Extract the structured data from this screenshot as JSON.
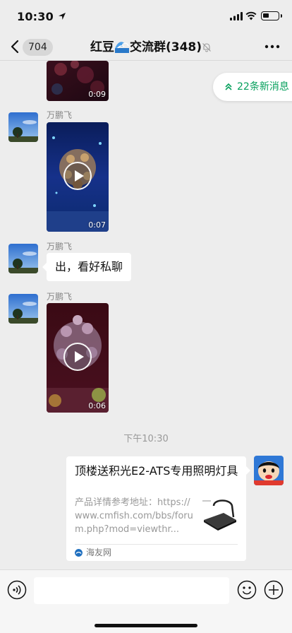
{
  "status_bar": {
    "time": "10:30"
  },
  "nav": {
    "back_count": "704",
    "title_prefix": "红豆",
    "title_suffix": "交流群(348)"
  },
  "new_messages": {
    "label": "22条新消息"
  },
  "messages": [
    {
      "type": "video",
      "duration": "0:09"
    },
    {
      "type": "video",
      "sender": "万鹏飞",
      "duration": "0:07"
    },
    {
      "type": "text",
      "sender": "万鹏飞",
      "text": "出，看好私聊"
    },
    {
      "type": "video",
      "sender": "万鹏飞",
      "duration": "0:06"
    }
  ],
  "timestamp": "下午10:30",
  "link_card": {
    "title": "顶楼送积光E2-ATS专用照明灯具",
    "description": "产品详情参考地址：https://www.cmfish.com/bbs/forum.php?mod=viewthr...",
    "source": "海友网"
  },
  "input": {
    "placeholder": ""
  },
  "colors": {
    "accent_green": "#07a05d",
    "background": "#ededed",
    "bubble": "#ffffff"
  }
}
